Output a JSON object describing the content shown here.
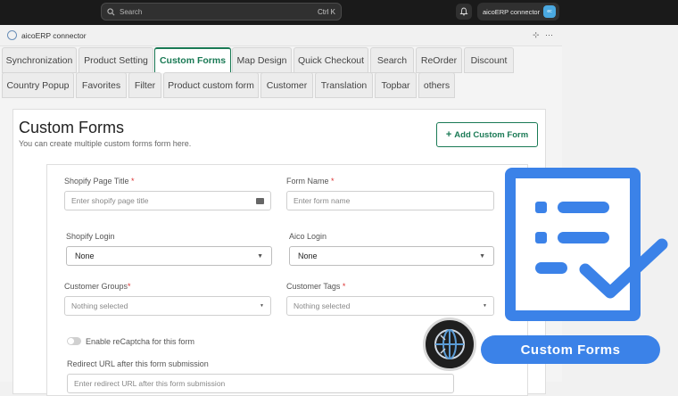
{
  "topbar": {
    "search_placeholder": "Search",
    "shortcut": "Ctrl K",
    "store_name": "aicoERP connector",
    "store_avatar": "ec"
  },
  "app": {
    "title": "aicoERP connector",
    "tools": "⊹ ⋯"
  },
  "tabs_row1": [
    {
      "label": "Synchronization"
    },
    {
      "label": "Product Setting"
    },
    {
      "label": "Custom Forms"
    },
    {
      "label": "Map Design"
    },
    {
      "label": "Quick Checkout"
    },
    {
      "label": "Search"
    },
    {
      "label": "ReOrder"
    },
    {
      "label": "Discount"
    }
  ],
  "tabs_row2": [
    {
      "label": "Country Popup"
    },
    {
      "label": "Favorites"
    },
    {
      "label": "Filter"
    },
    {
      "label": "Product custom form"
    },
    {
      "label": "Customer"
    },
    {
      "label": "Translation"
    },
    {
      "label": "Topbar"
    },
    {
      "label": "others"
    }
  ],
  "active_tab": "Custom Forms",
  "main": {
    "title": "Custom Forms",
    "subtitle": "You can create multiple custom forms form here.",
    "add_button": "Add Custom Form"
  },
  "form": {
    "shopify_page_title_label": "Shopify Page Title ",
    "shopify_page_title_placeholder": "Enter shopify page title",
    "form_name_label": "Form Name ",
    "form_name_placeholder": "Enter form name",
    "required_mark": "*",
    "shopify_login_label": "Shopify Login",
    "shopify_login_value": "None",
    "aico_login_label": "Aico Login",
    "aico_login_value": "None",
    "customer_groups_label": "Customer Groups",
    "customer_groups_value": "Nothing selected",
    "customer_tags_label": "Customer Tags ",
    "customer_tags_value": "Nothing selected",
    "recaptcha_label": "Enable reCaptcha for this form",
    "recaptcha_enabled": false,
    "redirect_label": "Redirect URL after this form submission",
    "redirect_placeholder": "Enter redirect URL after this form submission"
  },
  "promo": {
    "label": "Custom Forms",
    "accent": "#3b82e8"
  },
  "colors": {
    "brand": "#1a7a55",
    "required": "#d33333"
  }
}
